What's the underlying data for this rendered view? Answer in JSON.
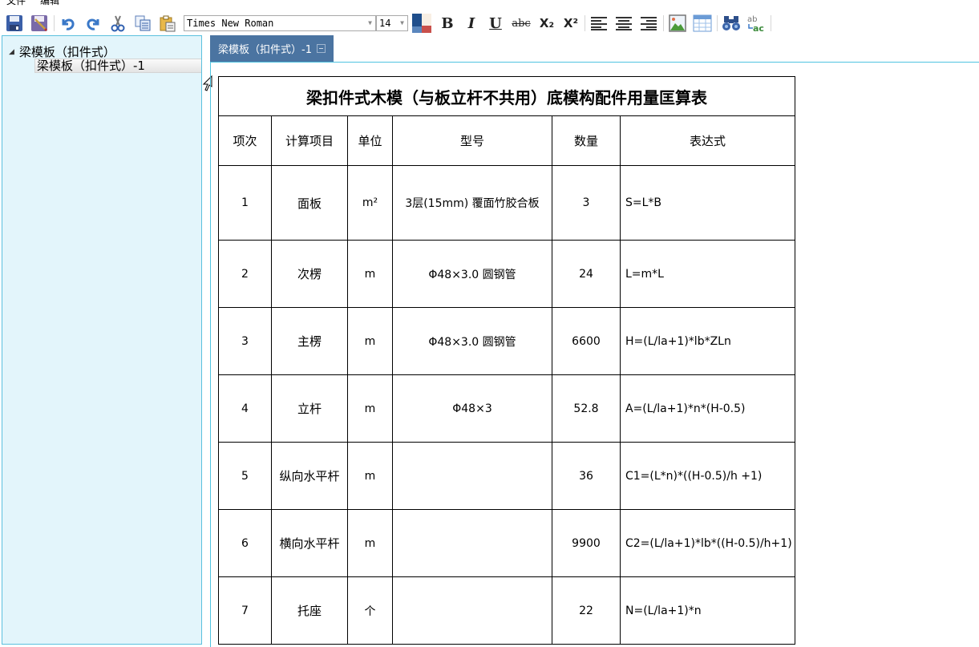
{
  "menu": {
    "items": [
      "文件",
      "编辑"
    ]
  },
  "toolbar": {
    "buttons": [
      "save",
      "save-as",
      "undo",
      "redo",
      "cut",
      "copy",
      "paste"
    ],
    "font_family": "Times New Roman",
    "font_size": "14",
    "color_fore": "#1f4e8c",
    "color_back": "#c9504b",
    "format_buttons": {
      "bold": "B",
      "italic": "I",
      "underline": "U",
      "strike": "abc",
      "subscript": "X₂",
      "superscript": "X²"
    }
  },
  "tree": {
    "root_label": "梁模板（扣件式）",
    "child_label": "梁模板（扣件式）-1"
  },
  "tab": {
    "label": "梁模板（扣件式）-1"
  },
  "table": {
    "title": "梁扣件式木模（与板立杆不共用）底模构配件用量匡算表",
    "headers": [
      "项次",
      "计算项目",
      "单位",
      "型号",
      "数量",
      "表达式"
    ],
    "rows": [
      {
        "no": "1",
        "item": "面板",
        "unit": "m²",
        "model": "3层(15mm) 覆面竹胶合板",
        "qty": "3",
        "expr": "S=L*B"
      },
      {
        "no": "2",
        "item": "次楞",
        "unit": "m",
        "model": "Φ48×3.0 圆钢管",
        "qty": "24",
        "expr": "L=m*L"
      },
      {
        "no": "3",
        "item": "主楞",
        "unit": "m",
        "model": "Φ48×3.0 圆钢管",
        "qty": "6600",
        "expr": "H=(L/la+1)*lb*ZLn"
      },
      {
        "no": "4",
        "item": "立杆",
        "unit": "m",
        "model": "Φ48×3",
        "qty": "52.8",
        "expr": "A=(L/la+1)*n*(H-0.5)"
      },
      {
        "no": "5",
        "item": "纵向水平杆",
        "unit": "m",
        "model": "",
        "qty": "36",
        "expr": "C1=(L*n)*((H-0.5)/h +1)"
      },
      {
        "no": "6",
        "item": "横向水平杆",
        "unit": "m",
        "model": "",
        "qty": "9900",
        "expr": "C2=(L/la+1)*lb*((H-0.5)/h+1)"
      },
      {
        "no": "7",
        "item": "托座",
        "unit": "个",
        "model": "",
        "qty": "22",
        "expr": "N=(L/la+1)*n"
      }
    ]
  }
}
